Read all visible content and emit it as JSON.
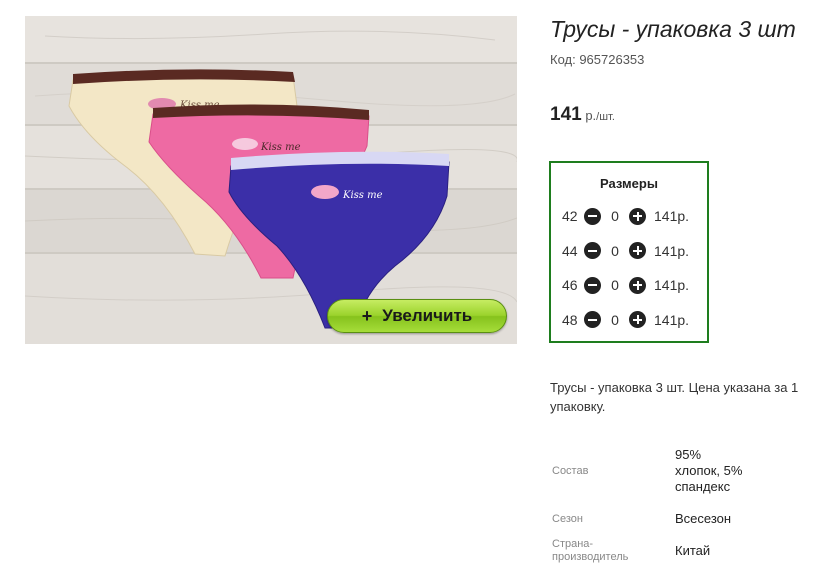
{
  "product": {
    "title": "Трусы - упаковка 3 шт",
    "code": "Код: 965726353",
    "price_amount": "141",
    "price_unit": " р.",
    "price_per": "/шт.",
    "image_text": "Kiss me",
    "zoom_label": "Увеличить",
    "zoom_plus": "+"
  },
  "sizes": {
    "heading": "Размеры",
    "rows": [
      {
        "size": "42",
        "qty": "0",
        "price": "141р."
      },
      {
        "size": "44",
        "qty": "0",
        "price": "141р."
      },
      {
        "size": "46",
        "qty": "0",
        "price": "141р."
      },
      {
        "size": "48",
        "qty": "0",
        "price": "141р."
      }
    ]
  },
  "description": "Трусы - упаковка 3 шт. Цена указана за 1 упаковку.",
  "properties": [
    {
      "key": "Состав",
      "value": "95% хлопок, 5% спандекс"
    },
    {
      "key": "Сезон",
      "value": "Всесезон"
    },
    {
      "key": "Страна-производитель",
      "value": "Китай"
    }
  ],
  "colors": {
    "sizes_border": "#1e7d1e",
    "zoom_button": "#9bd32c",
    "panty_cream": "#f3e7c6",
    "panty_pink": "#ee6aa3",
    "panty_blue": "#3b2fa8",
    "waistband_brown": "#5a2a22"
  },
  "icons": {
    "minus": "minus-circle-icon",
    "plus": "plus-circle-icon"
  }
}
